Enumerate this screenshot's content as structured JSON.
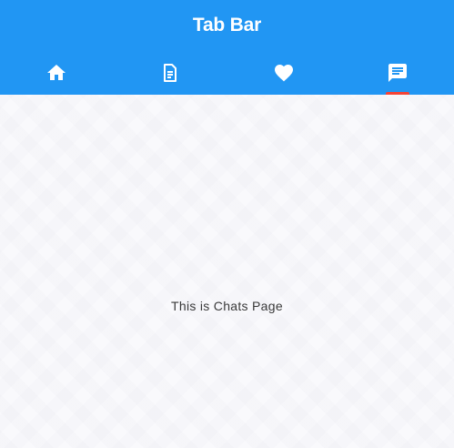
{
  "app_bar": {
    "title": "Tab Bar",
    "background_color": "#2196f3"
  },
  "tabs": [
    {
      "icon": "home-icon",
      "selected": false
    },
    {
      "icon": "article-icon",
      "selected": false
    },
    {
      "icon": "favorite-icon",
      "selected": false
    },
    {
      "icon": "chat-icon",
      "selected": true
    }
  ],
  "indicator_color": "#f44336",
  "content": {
    "text": "This is Chats Page"
  }
}
